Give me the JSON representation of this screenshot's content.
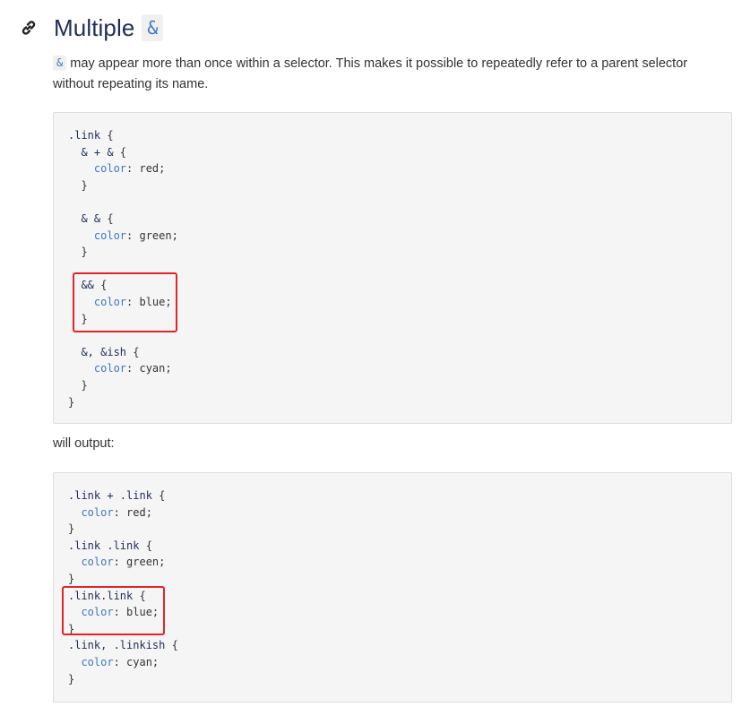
{
  "heading": {
    "title": "Multiple",
    "code": "&"
  },
  "intro": {
    "code": "&",
    "text": " may appear more than once within a selector. This makes it possible to repeatedly refer to a parent selector without repeating its name."
  },
  "input_code": [
    ".link {",
    "  & + & {",
    "    color: red;",
    "  }",
    "",
    "  & & {",
    "    color: green;",
    "  }",
    "",
    "  && {",
    "    color: blue;",
    "  }",
    "",
    "  &, &ish {",
    "    color: cyan;",
    "  }",
    "}"
  ],
  "between_text": "will output:",
  "output_code": [
    ".link + .link {",
    "  color: red;",
    "}",
    ".link .link {",
    "  color: green;",
    "}",
    ".link.link {",
    "  color: blue;",
    "}",
    ".link, .linkish {",
    "  color: cyan;",
    "}"
  ],
  "colors": {
    "heading": "#1f2d57",
    "code_keyword": "#3c78c0",
    "highlight": "#e0242c",
    "code_background": "#f5f5f5"
  }
}
